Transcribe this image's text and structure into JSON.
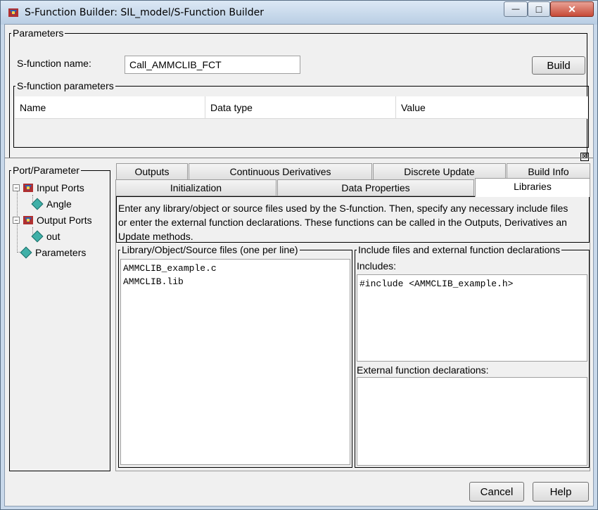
{
  "window": {
    "title": "S-Function Builder: SIL_model/S-Function Builder",
    "minimize_glyph": "—",
    "maximize_glyph": "□",
    "close_glyph": "✕"
  },
  "parameters": {
    "group_title": "Parameters",
    "sfname_label": "S-function name:",
    "sfname_value": "Call_AMMCLIB_FCT",
    "build_label": "Build",
    "sfparams_title": "S-function parameters",
    "table_headers": [
      "Name",
      "Data type",
      "Value"
    ],
    "collapse_glyph": "⊠"
  },
  "tree": {
    "title": "Port/Parameter",
    "input_ports": "Input Ports",
    "angle": "Angle",
    "output_ports": "Output Ports",
    "out": "out",
    "parameters": "Parameters"
  },
  "tabs": {
    "row1": [
      "Outputs",
      "Continuous Derivatives",
      "Discrete Update",
      "Build Info"
    ],
    "row2": [
      "Initialization",
      "Data Properties",
      "Libraries"
    ],
    "active": "Libraries"
  },
  "libraries": {
    "description_lines": [
      "Enter any library/object or source files used by the S-function. Then, specify any necessary include files",
      "or enter the external function declarations. These functions can be called in the Outputs, Derivatives an",
      "Update methods."
    ],
    "lib_title": "Library/Object/Source files (one per line)",
    "lib_lines": [
      "AMMCLIB_example.c",
      "AMMCLIB.lib"
    ],
    "inc_title": "Include files and external function declarations",
    "includes_label": "Includes:",
    "includes_value": "#include <AMMCLIB_example.h>",
    "ext_label": "External function declarations:",
    "ext_value": ""
  },
  "footer": {
    "cancel_label": "Cancel",
    "help_label": "Help"
  },
  "colors": {
    "titlebar": "#c8d8ea",
    "close_button": "#c74a37",
    "panel_bg": "#f0f0f0",
    "diamond_icon": "#3fb0a8"
  }
}
